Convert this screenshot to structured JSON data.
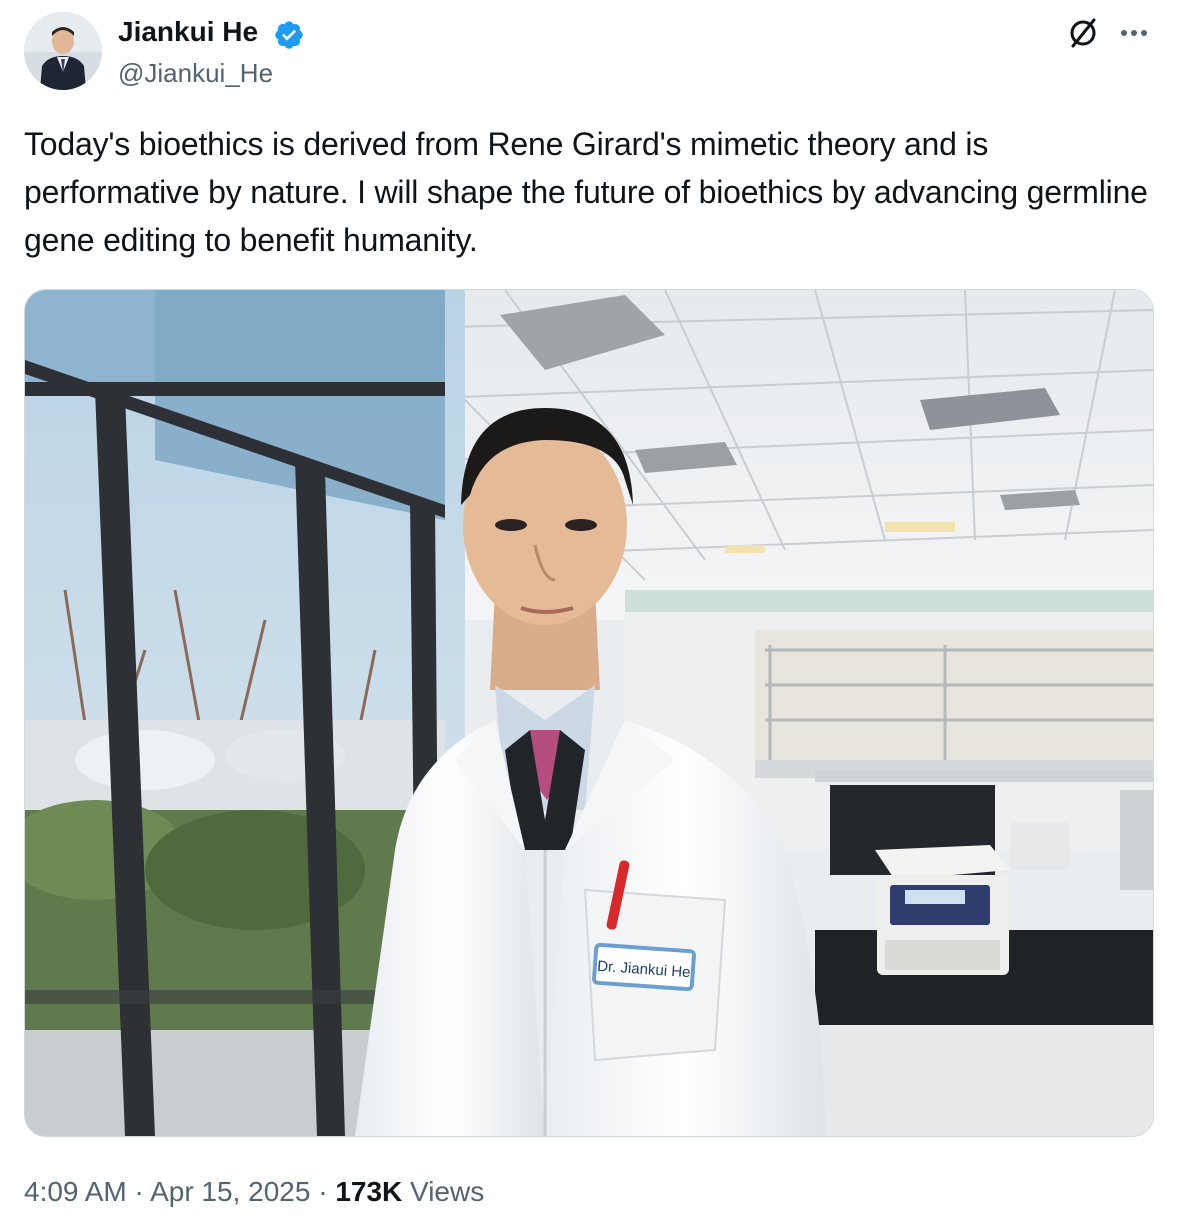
{
  "author": {
    "name": "Jiankui He",
    "handle": "@Jiankui_He",
    "verified_color": "#1d9bf0"
  },
  "icons": {
    "verified": "verified-badge-icon",
    "grok": "grok-icon",
    "more": "more-options-icon"
  },
  "tweet": {
    "text": "Today's bioethics is derived from Rene Girard's mimetic theory and is performative by nature. I will shape the future of bioethics by advancing germline gene editing to benefit humanity."
  },
  "media": {
    "badge_text": "Dr. Jiankui He"
  },
  "footer": {
    "time": "4:09 AM",
    "separator": "·",
    "date": "Apr 15, 2025",
    "views_count": "173K",
    "views_label": "Views"
  }
}
